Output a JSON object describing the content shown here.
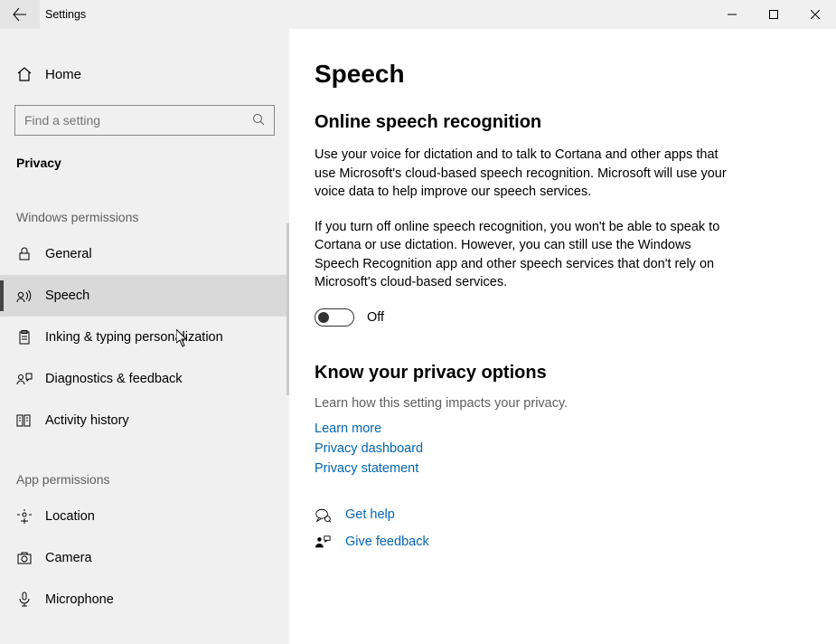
{
  "window": {
    "title": "Settings"
  },
  "sidebar": {
    "home_label": "Home",
    "search_placeholder": "Find a setting",
    "category_label": "Privacy",
    "section1_label": "Windows permissions",
    "items1": [
      {
        "name": "general",
        "label": "General"
      },
      {
        "name": "speech",
        "label": "Speech"
      },
      {
        "name": "inking",
        "label": "Inking & typing personalization"
      },
      {
        "name": "diagnostics",
        "label": "Diagnostics & feedback"
      },
      {
        "name": "activity",
        "label": "Activity history"
      }
    ],
    "section2_label": "App permissions",
    "items2": [
      {
        "name": "location",
        "label": "Location"
      },
      {
        "name": "camera",
        "label": "Camera"
      },
      {
        "name": "microphone",
        "label": "Microphone"
      }
    ]
  },
  "main": {
    "page_title": "Speech",
    "h2a": "Online speech recognition",
    "para1": "Use your voice for dictation and to talk to Cortana and other apps that use Microsoft's cloud-based speech recognition. Microsoft will use your voice data to help improve our speech services.",
    "para2": "If you turn off online speech recognition, you won't be able to speak to Cortana or use dictation. However, you can still use the Windows Speech Recognition app and other speech services that don't rely on Microsoft's cloud-based services.",
    "toggle_state_label": "Off",
    "toggle_on": false,
    "h2b": "Know your privacy options",
    "privacy_sub": "Learn how this setting impacts your privacy.",
    "links": {
      "learn_more": "Learn more",
      "dashboard": "Privacy dashboard",
      "statement": "Privacy statement"
    },
    "help_label": "Get help",
    "feedback_label": "Give feedback"
  }
}
